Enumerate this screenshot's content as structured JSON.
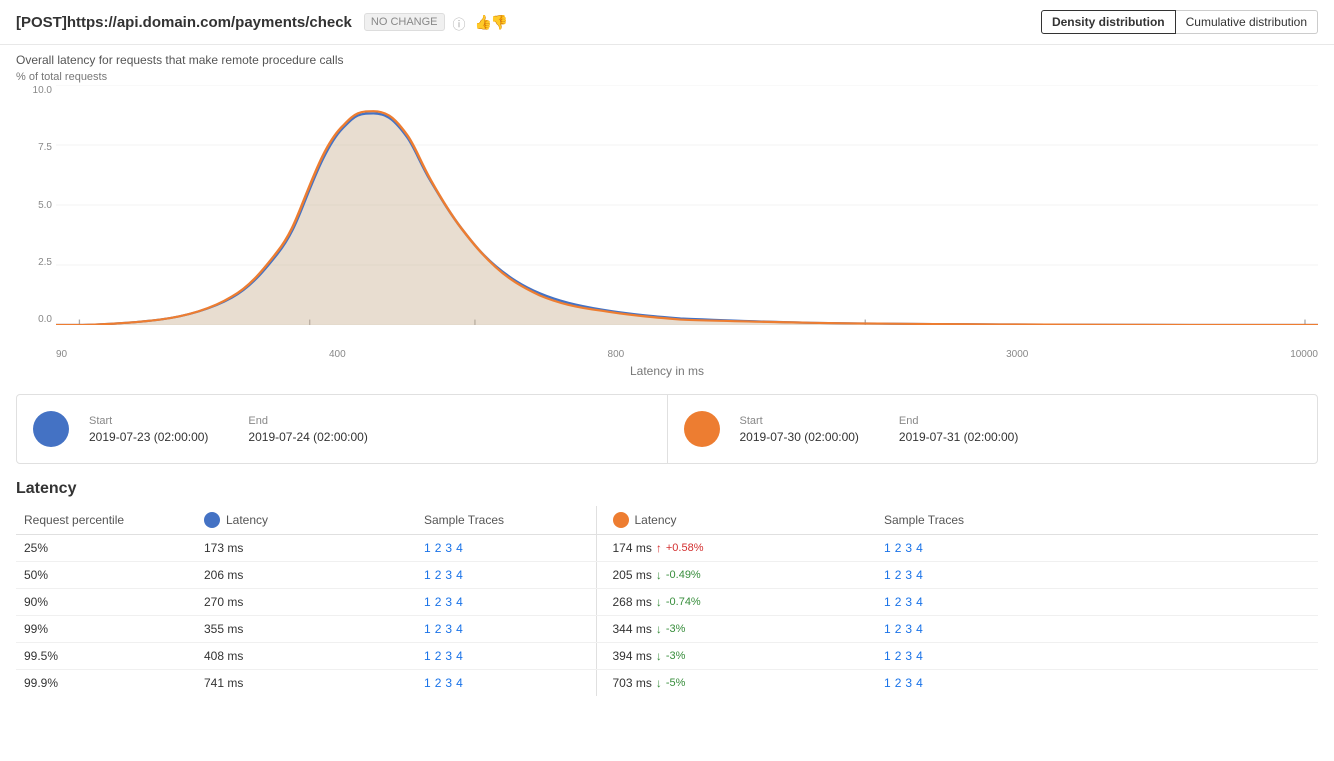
{
  "header": {
    "title": "[POST]https://api.domain.com/payments/check",
    "badge": "NO CHANGE",
    "dist_buttons": [
      {
        "label": "Density distribution",
        "active": true
      },
      {
        "label": "Cumulative distribution",
        "active": false
      }
    ]
  },
  "chart": {
    "subtitle": "Overall latency for requests that make remote procedure calls",
    "y_axis_label": "% of total requests",
    "x_axis_title": "Latency in ms",
    "y_ticks": [
      "10.0",
      "7.5",
      "5.0",
      "2.5",
      "0.0"
    ],
    "x_labels": [
      "90",
      "400",
      "800",
      "3000",
      "10000"
    ]
  },
  "legend": {
    "left": {
      "dot_class": "blue",
      "start_label": "Start",
      "start_value": "2019-07-23 (02:00:00)",
      "end_label": "End",
      "end_value": "2019-07-24 (02:00:00)"
    },
    "right": {
      "dot_class": "orange",
      "start_label": "Start",
      "start_value": "2019-07-30 (02:00:00)",
      "end_label": "End",
      "end_value": "2019-07-31 (02:00:00)"
    }
  },
  "latency_section": {
    "title": "Latency",
    "col_headers": {
      "percentile": "Request percentile",
      "latency_blue": "Latency",
      "sample_traces_blue": "Sample Traces",
      "latency_orange": "Latency",
      "sample_traces_orange": "Sample Traces"
    },
    "rows": [
      {
        "percentile": "25%",
        "latency_blue": "173 ms",
        "traces_blue": [
          "1",
          "2",
          "3",
          "4"
        ],
        "latency_orange": "174 ms",
        "change_direction": "up",
        "change_value": "+0.58%",
        "traces_orange": [
          "1",
          "2",
          "3",
          "4"
        ]
      },
      {
        "percentile": "50%",
        "latency_blue": "206 ms",
        "traces_blue": [
          "1",
          "2",
          "3",
          "4"
        ],
        "latency_orange": "205 ms",
        "change_direction": "down",
        "change_value": "-0.49%",
        "traces_orange": [
          "1",
          "2",
          "3",
          "4"
        ]
      },
      {
        "percentile": "90%",
        "latency_blue": "270 ms",
        "traces_blue": [
          "1",
          "2",
          "3",
          "4"
        ],
        "latency_orange": "268 ms",
        "change_direction": "down",
        "change_value": "-0.74%",
        "traces_orange": [
          "1",
          "2",
          "3",
          "4"
        ]
      },
      {
        "percentile": "99%",
        "latency_blue": "355 ms",
        "traces_blue": [
          "1",
          "2",
          "3",
          "4"
        ],
        "latency_orange": "344 ms",
        "change_direction": "down",
        "change_value": "-3%",
        "traces_orange": [
          "1",
          "2",
          "3",
          "4"
        ]
      },
      {
        "percentile": "99.5%",
        "latency_blue": "408 ms",
        "traces_blue": [
          "1",
          "2",
          "3",
          "4"
        ],
        "latency_orange": "394 ms",
        "change_direction": "down",
        "change_value": "-3%",
        "traces_orange": [
          "1",
          "2",
          "3",
          "4"
        ]
      },
      {
        "percentile": "99.9%",
        "latency_blue": "741 ms",
        "traces_blue": [
          "1",
          "2",
          "3",
          "4"
        ],
        "latency_orange": "703 ms",
        "change_direction": "down",
        "change_value": "-5%",
        "traces_orange": [
          "1",
          "2",
          "3",
          "4"
        ]
      }
    ]
  }
}
